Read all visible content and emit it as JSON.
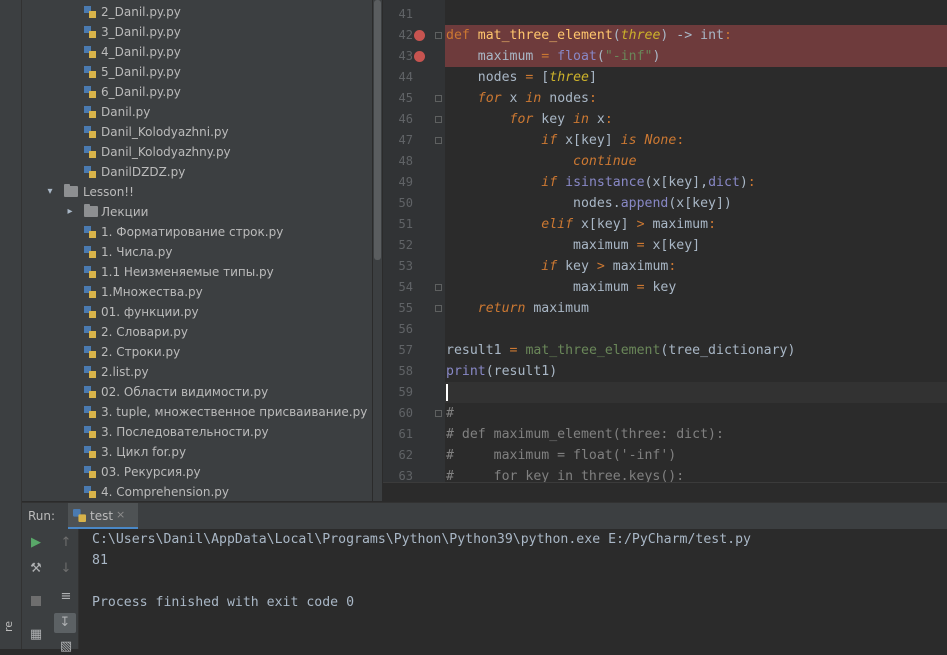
{
  "side_strip_label": "re",
  "project_tree": {
    "danil_files": [
      "2_Danil.py.py",
      "3_Danil.py.py",
      "4_Danil.py.py",
      "5_Danil.py.py",
      "6_Danil.py.py",
      "Danil.py",
      "Danil_Kolodyazhni.py",
      "Danil_Kolodyazhny.py",
      "DanilDZDZ.py"
    ],
    "folder_lesson": "Lesson!!",
    "folder_lectures": "Лекции",
    "lesson_files": [
      "1. Форматирование строк.py",
      "1. Числа.py",
      "1.1 Неизменяемые типы.py",
      "1.Множества.py",
      "01. функции.py",
      "2. Словари.py",
      "2. Строки.py",
      "2.list.py",
      "02. Области видимости.py",
      "3. tuple, множественное присваивание.py",
      "3. Последовательности.py",
      "3. Цикл for.py",
      "03. Рекурсия.py",
      "4. Comprehension.py"
    ]
  },
  "editor": {
    "line_numbers": [
      "41",
      "42",
      "43",
      "44",
      "45",
      "46",
      "47",
      "48",
      "49",
      "50",
      "51",
      "52",
      "53",
      "54",
      "55",
      "56",
      "57",
      "58",
      "59",
      "60",
      "61",
      "62",
      "63"
    ],
    "code": {
      "l42": {
        "def": "def",
        "name": "mat_three_element",
        "open": "(",
        "param": "three",
        "close": ") -> ",
        "ret": "int",
        "colon": ":"
      },
      "l43": {
        "indent": "    ",
        "var": "maximum",
        "eq": " = ",
        "fn": "float",
        "open": "(",
        "str": "\"-inf\"",
        "close": ")"
      },
      "l44": {
        "indent": "    ",
        "var": "nodes",
        "eq": " = ",
        "open": "[",
        "param": "three",
        "close": "]"
      },
      "l45": {
        "indent": "    ",
        "kw": "for",
        "mid": " x ",
        "kw2": "in",
        "rest": " nodes",
        "colon": ":"
      },
      "l46": {
        "indent": "        ",
        "kw": "for",
        "mid": " key ",
        "kw2": "in",
        "rest": " x",
        "colon": ":"
      },
      "l47": {
        "indent": "            ",
        "kw": "if",
        "mid": " x[key] ",
        "kw2": "is",
        "sp": " ",
        "none": "None",
        "colon": ":"
      },
      "l48": {
        "indent": "                ",
        "kw": "continue"
      },
      "l49": {
        "indent": "            ",
        "kw": "if",
        "sp": " ",
        "fn": "isinstance",
        "mid": "(x[key],",
        "b": "dict",
        "close": ")",
        "colon": ":"
      },
      "l50": {
        "indent": "                ",
        "a": "nodes.",
        "fn": "append",
        "rest": "(x[key])"
      },
      "l51": {
        "indent": "            ",
        "kw": "elif",
        "mid": " x[key] ",
        "op": ">",
        "rest": " maximum",
        "colon": ":"
      },
      "l52": {
        "indent": "                ",
        "a": "maximum ",
        "op": "=",
        "rest": " x[key]"
      },
      "l53": {
        "indent": "            ",
        "kw": "if",
        "mid": " key ",
        "op": ">",
        "rest": " maximum",
        "colon": ":"
      },
      "l54": {
        "indent": "                ",
        "a": "maximum ",
        "op": "=",
        "rest": " key"
      },
      "l55": {
        "indent": "    ",
        "kw": "return",
        "rest": " maximum"
      },
      "l57": {
        "a": "result1 ",
        "op": "=",
        "sp": " ",
        "fn": "mat_three_element",
        "rest": "(tree_dictionary)"
      },
      "l58": {
        "fn": "print",
        "rest": "(result1)"
      },
      "l60": "#",
      "l61": "# def maximum_element(three: dict):",
      "l62": "#     maximum = float('-inf')",
      "l63": "#     for key in three.keys():"
    }
  },
  "run_panel": {
    "label": "Run:",
    "tab_name": "test",
    "tab_close": "×",
    "console_lines": [
      "C:\\Users\\Danil\\AppData\\Local\\Programs\\Python\\Python39\\python.exe E:/PyCharm/test.py",
      "81",
      "",
      "Process finished with exit code 0"
    ]
  },
  "colors": {
    "keyword": "#cc7832",
    "function_name": "#ffc66d",
    "string": "#6a8759",
    "builtin": "#8888c6",
    "comment": "#808080",
    "breakpoint": "#c75450",
    "breakpoint_line": "#6e3b3c"
  }
}
